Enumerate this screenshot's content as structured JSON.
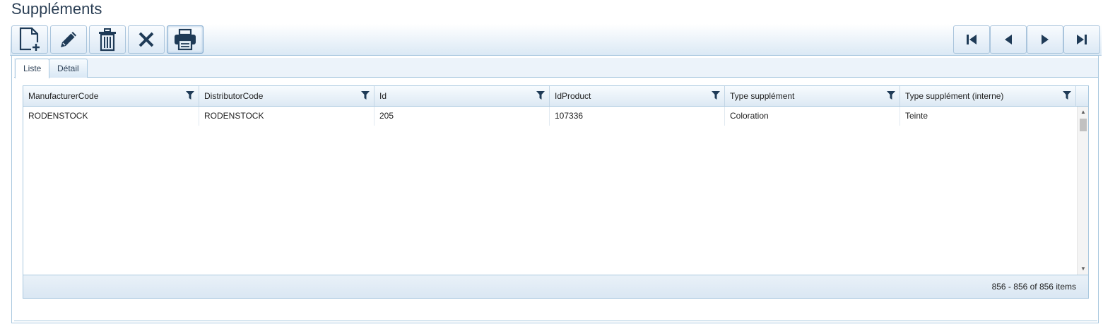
{
  "page": {
    "title": "Suppléments"
  },
  "toolbar": {
    "buttons": [
      {
        "name": "new-document",
        "icon": "new-document-icon"
      },
      {
        "name": "edit",
        "icon": "pencil-icon"
      },
      {
        "name": "delete",
        "icon": "trash-icon"
      },
      {
        "name": "cancel",
        "icon": "close-icon"
      },
      {
        "name": "print",
        "icon": "printer-icon"
      }
    ],
    "navigation": [
      {
        "name": "first",
        "icon": "first-page-icon"
      },
      {
        "name": "previous",
        "icon": "previous-icon"
      },
      {
        "name": "next",
        "icon": "next-icon"
      },
      {
        "name": "last",
        "icon": "last-page-icon"
      }
    ],
    "icon_color": "#1f3b57"
  },
  "tabs": [
    {
      "label": "Liste",
      "selected": true
    },
    {
      "label": "Détail",
      "selected": false
    }
  ],
  "grid": {
    "columns": [
      {
        "label": "ManufacturerCode"
      },
      {
        "label": "DistributorCode"
      },
      {
        "label": "Id"
      },
      {
        "label": "IdProduct"
      },
      {
        "label": "Type supplément"
      },
      {
        "label": "Type supplément (interne)"
      }
    ],
    "rows": [
      [
        "RODENSTOCK",
        "RODENSTOCK",
        "205",
        "107336",
        "Coloration",
        "Teinte"
      ]
    ],
    "footer": "856 - 856 of 856 items"
  }
}
